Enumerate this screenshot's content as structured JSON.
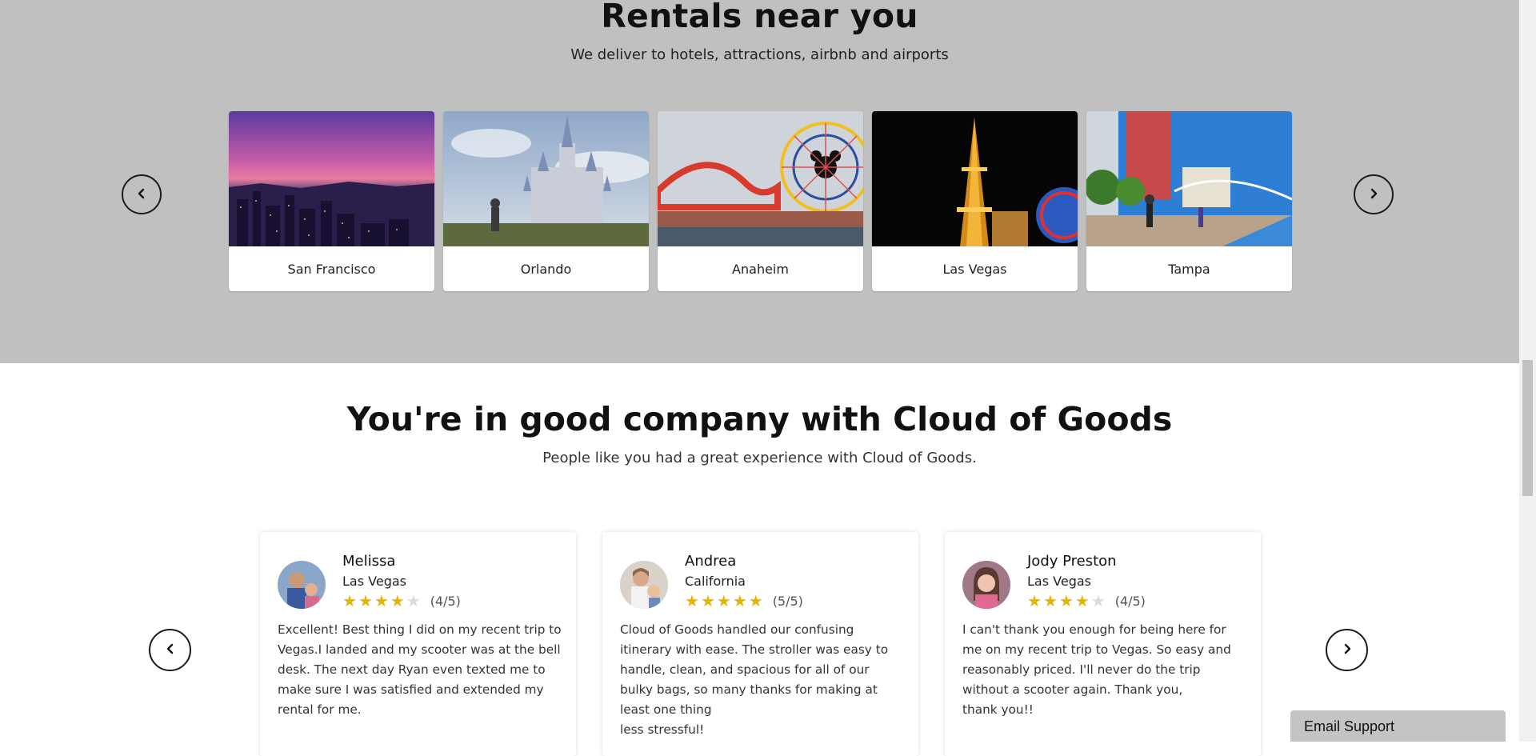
{
  "rentals": {
    "title": "Rentals near you",
    "subtitle": "We deliver to hotels, attractions, airbnb and airports",
    "cities": [
      {
        "name": "San Francisco"
      },
      {
        "name": "Orlando"
      },
      {
        "name": "Anaheim"
      },
      {
        "name": "Las Vegas"
      },
      {
        "name": "Tampa"
      }
    ],
    "prev_icon": "‹",
    "next_icon": "›"
  },
  "testimonials": {
    "title": "You're in good company with Cloud of Goods",
    "subtitle": "People like you had a great experience with Cloud of Goods.",
    "prev_icon": "‹",
    "next_icon": "›",
    "reviews": [
      {
        "name": "Melissa",
        "location": "Las Vegas",
        "rating": 4,
        "score": "(4/5)",
        "text": "Excellent! Best thing I did on my recent trip to Vegas.I landed and my scooter was at the bell desk. The next day Ryan even texted me to make sure I was satisfied and extended my rental for me."
      },
      {
        "name": "Andrea",
        "location": "California",
        "rating": 5,
        "score": "(5/5)",
        "text": "Cloud of Goods handled our confusing itinerary with ease. The stroller was easy to handle, clean, and spacious for all of our bulky bags, so many thanks for making at least one thing\nless stressful!"
      },
      {
        "name": "Jody Preston",
        "location": "Las Vegas",
        "rating": 4,
        "score": "(4/5)",
        "text": "I can't thank you enough for being here for me on my recent trip to Vegas. So easy and reasonably priced. I'll never do the trip without a scooter again. Thank you,\nthank you!!"
      }
    ]
  },
  "email_support": {
    "label": "Email Support"
  },
  "colors": {
    "section_grey": "#c0c0c0",
    "star": "#e8b400",
    "star_off": "#dadada"
  }
}
